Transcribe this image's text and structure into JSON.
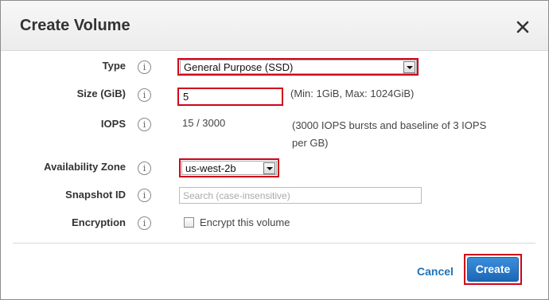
{
  "dialog": {
    "title": "Create Volume",
    "close_icon": "close-icon"
  },
  "form": {
    "type": {
      "label": "Type",
      "value": "General Purpose (SSD)"
    },
    "size": {
      "label": "Size (GiB)",
      "value": "5",
      "hint": "(Min: 1GiB, Max: 1024GiB)"
    },
    "iops": {
      "label": "IOPS",
      "value": "15 / 3000",
      "note": "(3000 IOPS bursts and baseline of 3 IOPS per GB)"
    },
    "availability_zone": {
      "label": "Availability Zone",
      "value": "us-west-2b"
    },
    "snapshot_id": {
      "label": "Snapshot ID",
      "placeholder": "Search (case-insensitive)"
    },
    "encryption": {
      "label": "Encryption",
      "checkbox_label": "Encrypt this volume",
      "checked": false
    },
    "info_glyph": "i"
  },
  "footer": {
    "cancel_label": "Cancel",
    "create_label": "Create"
  },
  "colors": {
    "highlight": "#d0021b",
    "primary": "#1c66b6",
    "link": "#1f71b8"
  }
}
